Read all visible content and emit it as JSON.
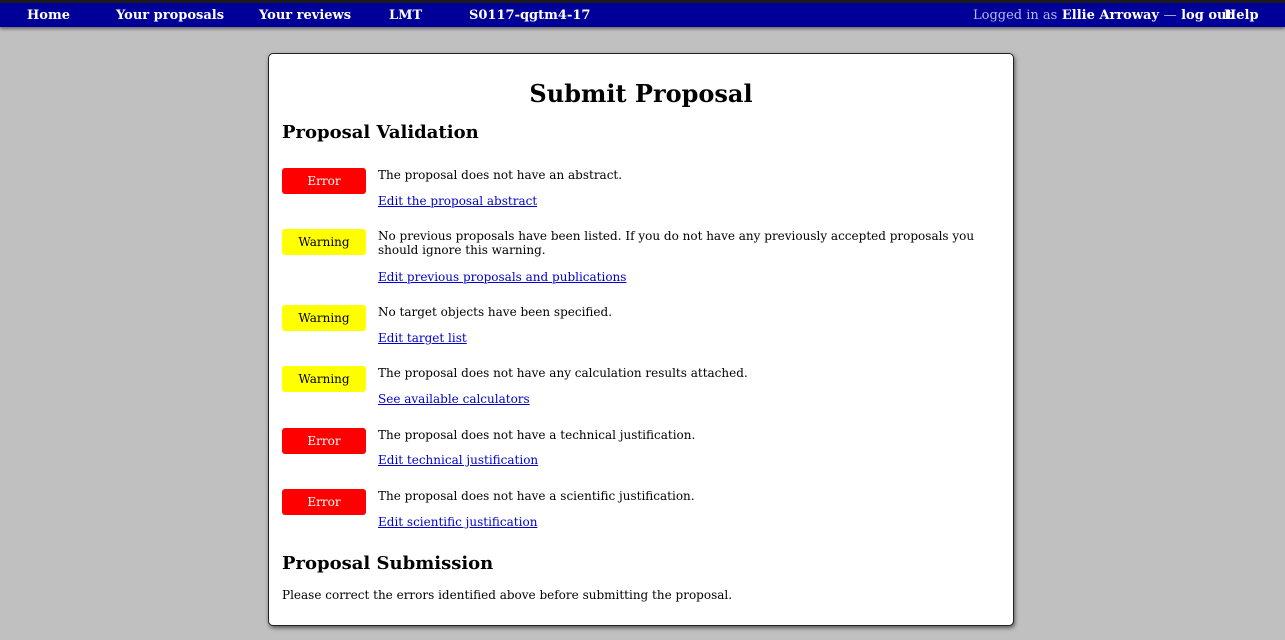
{
  "nav": {
    "home": "Home",
    "your_proposals": "Your proposals",
    "your_reviews": "Your reviews",
    "facility": "LMT",
    "proposal_code": "S0117-qgtm4-17",
    "logged_in_prefix": "Logged in as",
    "user_name": "Ellie Arroway",
    "separator": "—",
    "log_out": "log out",
    "help": "Help"
  },
  "page": {
    "title": "Submit Proposal",
    "validation_heading": "Proposal Validation",
    "submission_heading": "Proposal Submission",
    "submission_text": "Please correct the errors identified above before submitting the proposal."
  },
  "issues": [
    {
      "level": "Error",
      "message": "The proposal does not have an abstract.",
      "link": "Edit the proposal abstract"
    },
    {
      "level": "Warning",
      "message": "No previous proposals have been listed. If you do not have any previously accepted proposals you should ignore this warning.",
      "link": "Edit previous proposals and publications"
    },
    {
      "level": "Warning",
      "message": "No target objects have been specified.",
      "link": "Edit target list"
    },
    {
      "level": "Warning",
      "message": "The proposal does not have any calculation results attached.",
      "link": "See available calculators"
    },
    {
      "level": "Error",
      "message": "The proposal does not have a technical justification.",
      "link": "Edit technical justification"
    },
    {
      "level": "Error",
      "message": "The proposal does not have a scientific justification.",
      "link": "Edit scientific justification"
    }
  ],
  "colors": {
    "nav_background": "#000099",
    "page_background": "#c0c0c0",
    "error": "#ff0000",
    "warning": "#ffff00",
    "link": "#0000cc"
  }
}
